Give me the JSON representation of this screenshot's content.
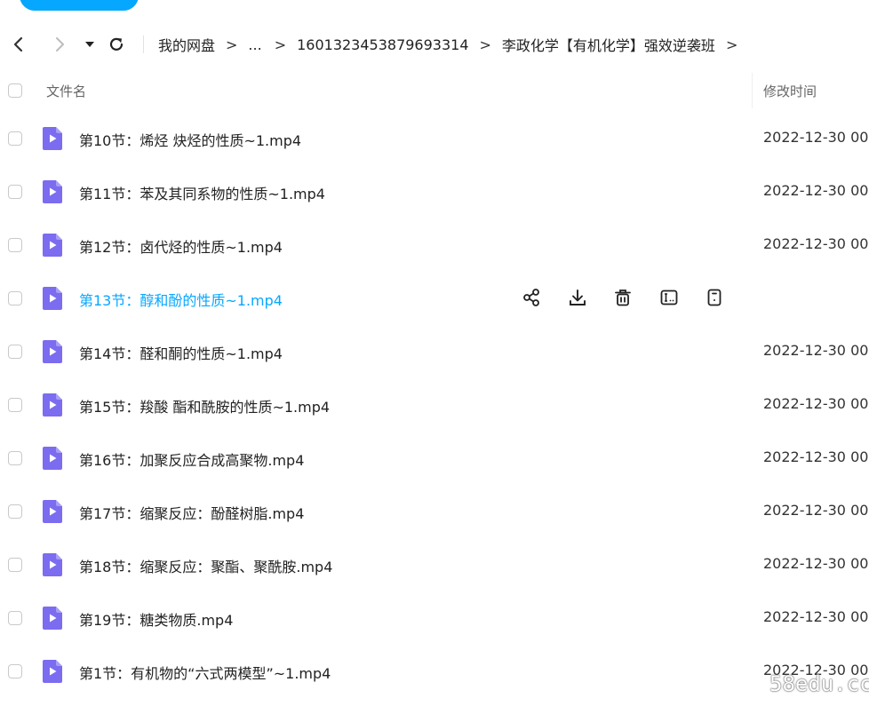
{
  "nav": {
    "breadcrumbs": [
      "我的网盘",
      "...",
      "1601323453879693314",
      "李政化学【有机化学】强效逆袭班"
    ],
    "separator": ">"
  },
  "columns": {
    "name": "文件名",
    "modified": "修改时间"
  },
  "files": [
    {
      "name": "第10节：烯烃 炔烃的性质~1.mp4",
      "time": "2022-12-30 00"
    },
    {
      "name": "第11节：苯及其同系物的性质~1.mp4",
      "time": "2022-12-30 00"
    },
    {
      "name": "第12节：卤代烃的性质~1.mp4",
      "time": "2022-12-30 00"
    },
    {
      "name": "第13节：醇和酚的性质~1.mp4",
      "time": ""
    },
    {
      "name": "第14节：醛和酮的性质~1.mp4",
      "time": "2022-12-30 00"
    },
    {
      "name": "第15节：羧酸 酯和酰胺的性质~1.mp4",
      "time": "2022-12-30 00"
    },
    {
      "name": "第16节：加聚反应合成高聚物.mp4",
      "time": "2022-12-30 00"
    },
    {
      "name": "第17节：缩聚反应：酚醛树脂.mp4",
      "time": "2022-12-30 00"
    },
    {
      "name": "第18节：缩聚反应：聚酯、聚酰胺.mp4",
      "time": "2022-12-30 00"
    },
    {
      "name": "第19节：糖类物质.mp4",
      "time": "2022-12-30 00"
    },
    {
      "name": "第1节：有机物的“六式两模型”~1.mp4",
      "time": "2022-12-30 00"
    }
  ],
  "row_actions": [
    "share-icon",
    "download-icon",
    "delete-icon",
    "rename-icon",
    "more-icon"
  ],
  "watermark": "58edu.cc",
  "colors": {
    "accent": "#06a7ff",
    "video_icon": "#7b6cf0"
  }
}
